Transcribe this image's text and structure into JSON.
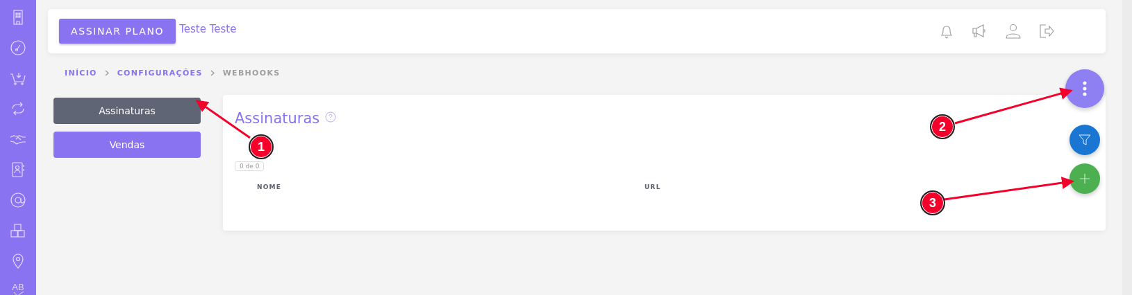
{
  "sidebar": {
    "language_label": "AB"
  },
  "header": {
    "plan_button": "ASSINAR PLANO",
    "user_name": "Teste Teste"
  },
  "breadcrumb": [
    {
      "label": "INÍCIO",
      "current": false
    },
    {
      "label": "CONFIGURAÇÕES",
      "current": false
    },
    {
      "label": "WEBHOOKS",
      "current": true
    }
  ],
  "menu": [
    {
      "label": "Assinaturas",
      "selected": true
    },
    {
      "label": "Vendas",
      "selected": false
    }
  ],
  "panel": {
    "title": "Assinaturas",
    "counter": "0 de 0",
    "columns": [
      "NOME",
      "URL"
    ]
  },
  "annotations": [
    {
      "label": "1"
    },
    {
      "label": "2"
    },
    {
      "label": "3"
    }
  ]
}
